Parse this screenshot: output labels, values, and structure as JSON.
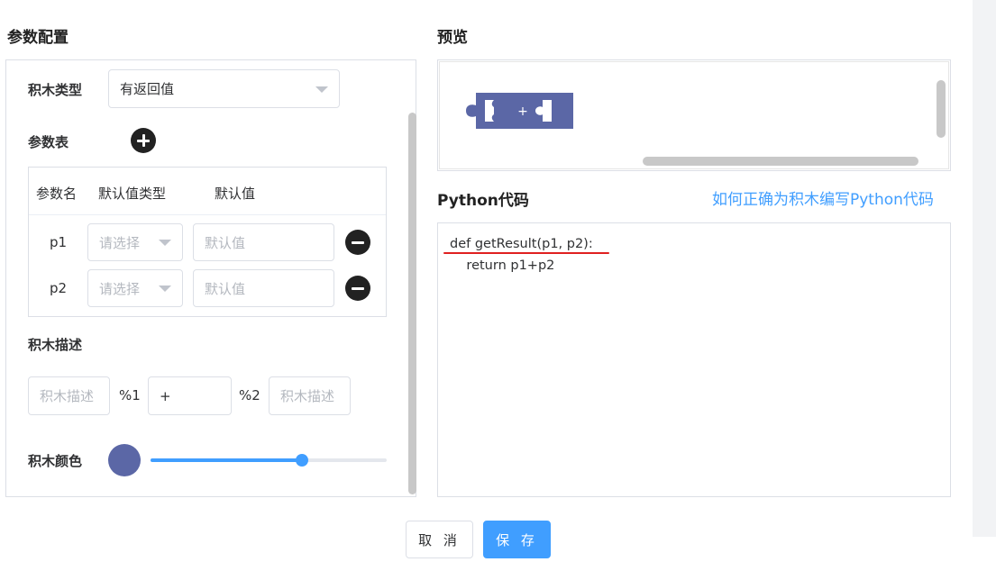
{
  "left": {
    "title": "参数配置",
    "block_type": {
      "label": "积木类型",
      "value": "有返回值"
    },
    "params": {
      "label": "参数表",
      "headers": [
        "参数名",
        "默认值类型",
        "默认值"
      ],
      "rows": [
        {
          "name": "p1",
          "type_placeholder": "请选择",
          "value_placeholder": "默认值"
        },
        {
          "name": "p2",
          "type_placeholder": "请选择",
          "value_placeholder": "默认值"
        }
      ]
    },
    "description": {
      "label": "积木描述",
      "placeholder1": "积木描述",
      "sep1": "%1",
      "middle_value": "+",
      "sep2": "%2",
      "placeholder2": "积木描述"
    },
    "color": {
      "label": "积木颜色",
      "value": "#5b67a6",
      "slider_percent": 64
    }
  },
  "right": {
    "preview_title": "预览",
    "block_text": "+",
    "block_color": "#5b67a6",
    "code_title": "Python代码",
    "help_link": "如何正确为积木编写Python代码",
    "code_lines": [
      "def getResult(p1, p2):",
      "    return p1+p2"
    ]
  },
  "footer": {
    "cancel": "取 消",
    "save": "保 存"
  }
}
